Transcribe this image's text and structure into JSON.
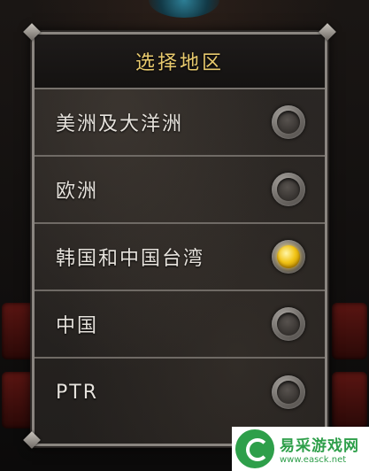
{
  "dialog": {
    "title": "选择地区",
    "options": [
      {
        "label": "美洲及大洋洲",
        "selected": false
      },
      {
        "label": "欧洲",
        "selected": false
      },
      {
        "label": "韩国和中国台湾",
        "selected": true
      },
      {
        "label": "中国",
        "selected": false
      },
      {
        "label": "PTR",
        "selected": false
      }
    ]
  },
  "watermark": {
    "name": "易采游戏网",
    "url": "www.easck.net"
  },
  "colors": {
    "title": "#e7c96d",
    "label": "#e6e2dc",
    "selected_radio": "#f2c417",
    "panel_border": "#8a8580"
  },
  "icons": {
    "radio_unselected": "radio-off-icon",
    "radio_selected": "radio-on-icon",
    "watermark_logo": "easck-logo-icon"
  }
}
